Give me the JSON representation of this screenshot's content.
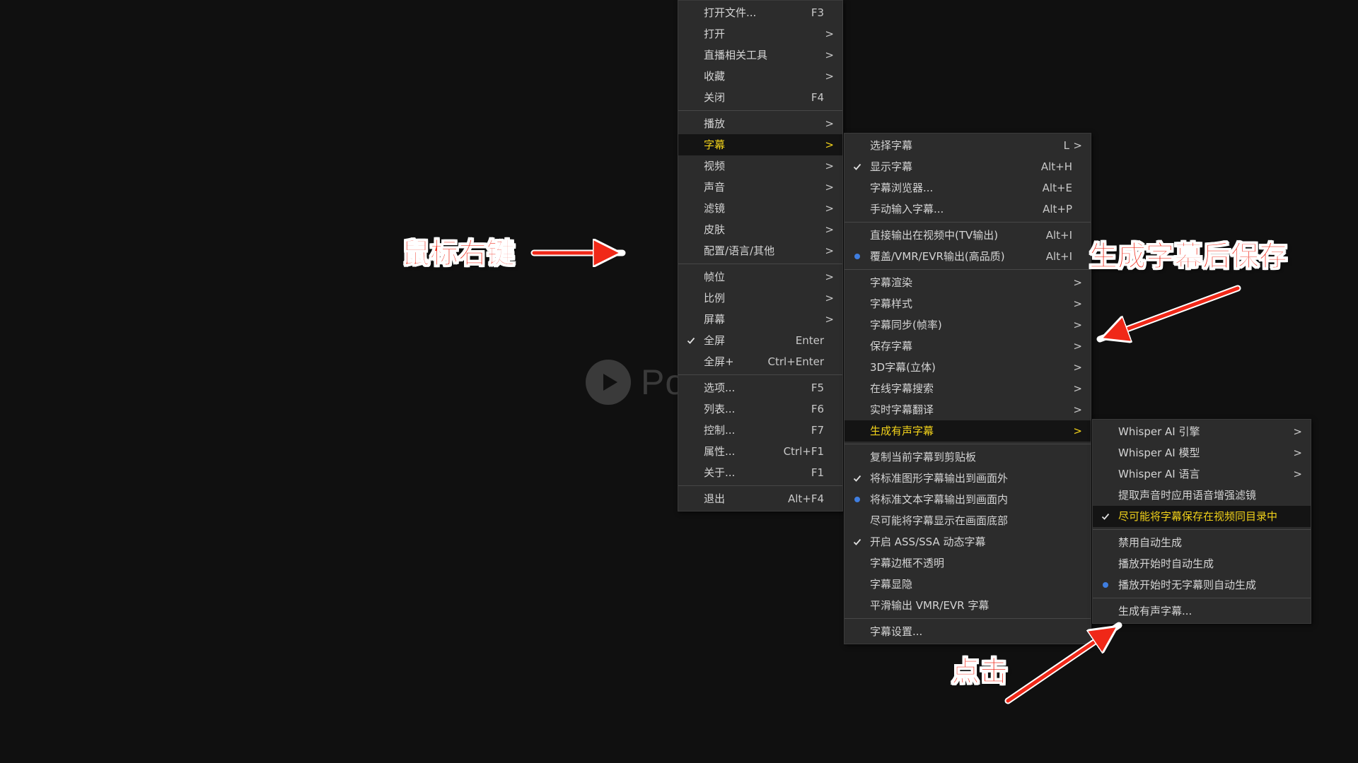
{
  "colors": {
    "background": "#101010",
    "menu_bg": "#2c2c2c",
    "highlight_text": "#f2d21a",
    "annotation_red": "#f02818",
    "radio_dot": "#3f7ee0"
  },
  "player": {
    "name_partial": "Po"
  },
  "main_menu": {
    "groups": [
      [
        {
          "label": "打开文件...",
          "shortcut": "F3"
        },
        {
          "label": "打开",
          "arrow": ">"
        },
        {
          "label": "直播相关工具",
          "arrow": ">"
        },
        {
          "label": "收藏",
          "arrow": ">"
        },
        {
          "label": "关闭",
          "shortcut": "F4"
        }
      ],
      [
        {
          "label": "播放",
          "arrow": ">"
        },
        {
          "label": "字幕",
          "arrow": ">",
          "active": true
        },
        {
          "label": "视频",
          "arrow": ">"
        },
        {
          "label": "声音",
          "arrow": ">"
        },
        {
          "label": "滤镜",
          "arrow": ">"
        },
        {
          "label": "皮肤",
          "arrow": ">"
        },
        {
          "label": "配置/语言/其他",
          "arrow": ">"
        }
      ],
      [
        {
          "label": "帧位",
          "arrow": ">"
        },
        {
          "label": "比例",
          "arrow": ">"
        },
        {
          "label": "屏幕",
          "arrow": ">"
        },
        {
          "label": "全屏",
          "shortcut": "Enter",
          "mark": "check"
        },
        {
          "label": "全屏+",
          "shortcut": "Ctrl+Enter"
        }
      ],
      [
        {
          "label": "选项...",
          "shortcut": "F5"
        },
        {
          "label": "列表...",
          "shortcut": "F6"
        },
        {
          "label": "控制...",
          "shortcut": "F7"
        },
        {
          "label": "属性...",
          "shortcut": "Ctrl+F1"
        },
        {
          "label": "关于...",
          "shortcut": "F1"
        }
      ],
      [
        {
          "label": "退出",
          "shortcut": "Alt+F4"
        }
      ]
    ]
  },
  "subtitle_menu": {
    "groups": [
      [
        {
          "label": "选择字幕",
          "shortcut": "L",
          "arrow": ">"
        },
        {
          "label": "显示字幕",
          "shortcut": "Alt+H",
          "mark": "check"
        },
        {
          "label": "字幕浏览器...",
          "shortcut": "Alt+E"
        },
        {
          "label": "手动输入字幕...",
          "shortcut": "Alt+P"
        }
      ],
      [
        {
          "label": "直接输出在视频中(TV输出)",
          "shortcut": "Alt+I"
        },
        {
          "label": "覆盖/VMR/EVR输出(高品质)",
          "shortcut": "Alt+I",
          "mark": "dot"
        }
      ],
      [
        {
          "label": "字幕渲染",
          "arrow": ">"
        },
        {
          "label": "字幕样式",
          "arrow": ">"
        },
        {
          "label": "字幕同步(帧率)",
          "arrow": ">"
        },
        {
          "label": "保存字幕",
          "arrow": ">"
        },
        {
          "label": "3D字幕(立体)",
          "arrow": ">"
        },
        {
          "label": "在线字幕搜索",
          "arrow": ">"
        },
        {
          "label": "实时字幕翻译",
          "arrow": ">"
        },
        {
          "label": "生成有声字幕",
          "arrow": ">",
          "active": true
        }
      ],
      [
        {
          "label": "复制当前字幕到剪贴板"
        },
        {
          "label": "将标准图形字幕输出到画面外",
          "mark": "check"
        },
        {
          "label": "将标准文本字幕输出到画面内",
          "mark": "dot"
        },
        {
          "label": "尽可能将字幕显示在画面底部"
        },
        {
          "label": "开启 ASS/SSA 动态字幕",
          "mark": "check"
        },
        {
          "label": "字幕边框不透明"
        },
        {
          "label": "字幕显隐"
        },
        {
          "label": "平滑输出 VMR/EVR 字幕"
        }
      ],
      [
        {
          "label": "字幕设置..."
        }
      ]
    ]
  },
  "generate_menu": {
    "groups": [
      [
        {
          "label": "Whisper AI 引擎",
          "arrow": ">"
        },
        {
          "label": "Whisper AI 模型",
          "arrow": ">"
        },
        {
          "label": "Whisper AI 语言",
          "arrow": ">"
        },
        {
          "label": "提取声音时应用语音增强滤镜"
        },
        {
          "label": "尽可能将字幕保存在视频同目录中",
          "mark": "check",
          "active": true
        }
      ],
      [
        {
          "label": "禁用自动生成"
        },
        {
          "label": "播放开始时自动生成"
        },
        {
          "label": "播放开始时无字幕则自动生成",
          "mark": "dot"
        }
      ],
      [
        {
          "label": "生成有声字幕..."
        }
      ]
    ]
  },
  "annotations": {
    "right_click": "鼠标右键",
    "save_after": "生成字幕后保存",
    "click": "点击"
  }
}
